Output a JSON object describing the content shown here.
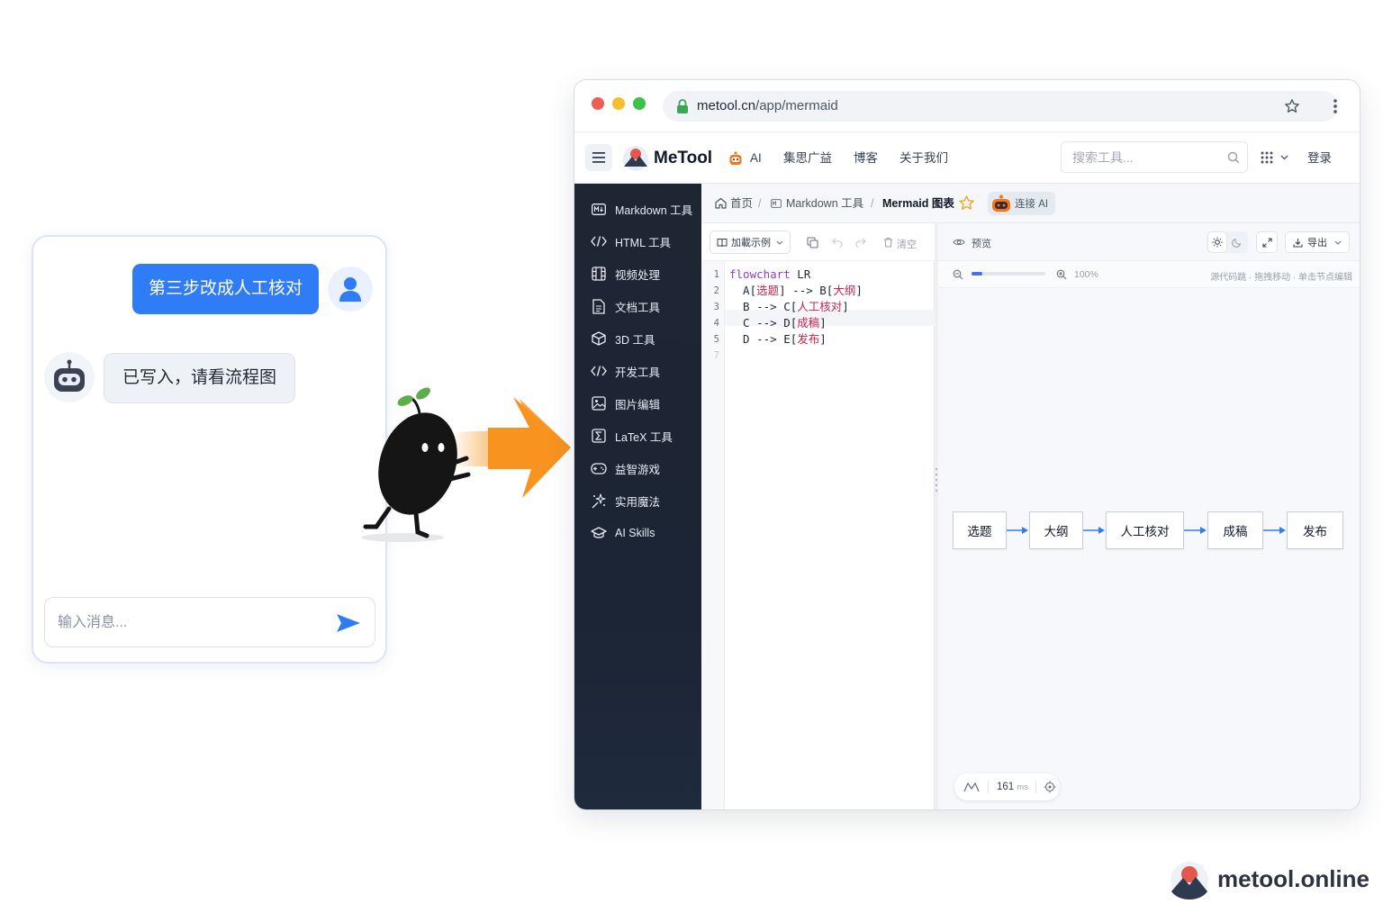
{
  "chat": {
    "user_message": "第三步改成人工核对",
    "bot_reply": "已写入，请看流程图",
    "input_placeholder": "输入消息..."
  },
  "browser": {
    "url_host": "metool.cn",
    "url_path": "/app/mermaid"
  },
  "navbar": {
    "brand": "MeTool",
    "items": [
      "AI",
      "集思广益",
      "博客",
      "关于我们"
    ],
    "search_placeholder": "搜索工具...",
    "login": "登录"
  },
  "sidebar": {
    "items": [
      {
        "label": "Markdown 工具",
        "icon": "markdown-icon"
      },
      {
        "label": "HTML 工具",
        "icon": "code-icon"
      },
      {
        "label": "视频处理",
        "icon": "film-icon"
      },
      {
        "label": "文档工具",
        "icon": "document-icon"
      },
      {
        "label": "3D 工具",
        "icon": "cube-icon"
      },
      {
        "label": "开发工具",
        "icon": "code-icon"
      },
      {
        "label": "图片编辑",
        "icon": "image-icon"
      },
      {
        "label": "LaTeX 工具",
        "icon": "formula-icon"
      },
      {
        "label": "益智游戏",
        "icon": "gamepad-icon"
      },
      {
        "label": "实用魔法",
        "icon": "sparkle-icon"
      },
      {
        "label": "AI Skills",
        "icon": "graduation-icon"
      }
    ]
  },
  "breadcrumb": {
    "home": "首页",
    "section": "Markdown 工具",
    "current": "Mermaid 图表",
    "connect_ai": "连接 AI"
  },
  "editor": {
    "load_example": "加載示例",
    "clear": "清空",
    "line_numbers": [
      "1",
      "2",
      "3",
      "4",
      "5",
      "7"
    ],
    "lines": [
      {
        "kw": "flowchart",
        "rest": " LR"
      },
      {
        "plain": "  A[",
        "str": "选题",
        "tail": "] --> B[",
        "str2": "大纲",
        "end": "]"
      },
      {
        "plain": "  B --> C[",
        "str": "人工核对",
        "end": "]"
      },
      {
        "plain": "  C --> D[",
        "str": "成稿",
        "end": "]"
      },
      {
        "plain": "  D --> E[",
        "str": "发布",
        "end": "]"
      }
    ]
  },
  "preview": {
    "title": "预览",
    "export": "导出",
    "zoom": "100%",
    "zoom_progress": 0.15,
    "hint": "源代码跳 · 拖拽移动 · 单击节点编辑",
    "render_time": "161",
    "render_unit": "ms",
    "nodes": [
      "选题",
      "大纲",
      "人工核对",
      "成稿",
      "发布"
    ]
  },
  "watermark": {
    "text": "metool.online"
  },
  "colors": {
    "accent": "#2f7cf6",
    "sidebar_bg": "#1e2533",
    "arrow_orange": "#f7931e",
    "flow_arrow": "#2f7cf6"
  }
}
